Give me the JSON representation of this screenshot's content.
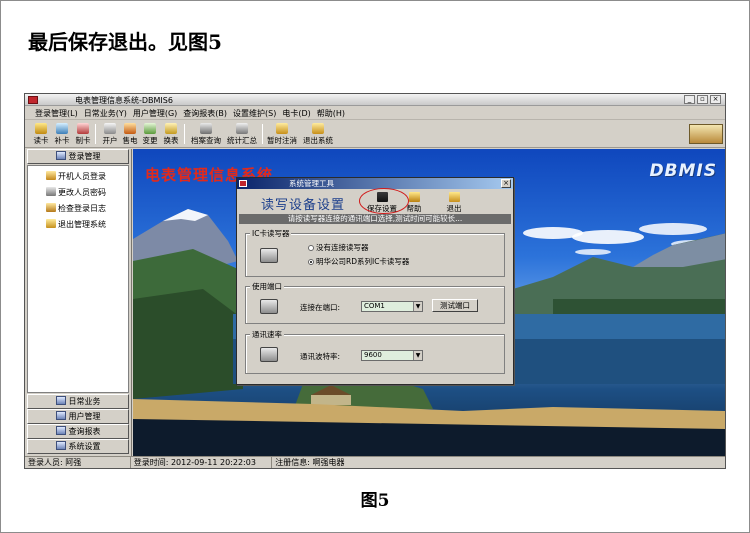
{
  "document": {
    "heading": "最后保存退出。见图5",
    "caption": "图5"
  },
  "app": {
    "title": "电表管理信息系统-DBMIS6",
    "window_buttons": [
      "_",
      "▫",
      "×"
    ],
    "menu": [
      "登录管理(L)",
      "日常业务(Y)",
      "用户管理(G)",
      "查询报表(B)",
      "设置维护(S)",
      "电卡(D)",
      "帮助(H)"
    ],
    "toolbar": [
      "读卡",
      "补卡",
      "制卡",
      "开户",
      "售电",
      "变更",
      "换表",
      "档案查询",
      "统计汇总",
      "暂时注消",
      "退出系统"
    ],
    "left_panel": {
      "top_header": "登录管理",
      "items": [
        "开机人员登录",
        "更改人员密码",
        "检查登录日志",
        "退出管理系统"
      ],
      "bottom_headers": [
        "日常业务",
        "用户管理",
        "查询报表",
        "系统设置"
      ]
    },
    "main": {
      "title": "电表管理信息系统",
      "brand": "DBMIS"
    },
    "status": {
      "user": "登录人员: 阿强",
      "time": "登录时间: 2012-09-11 20:22:03",
      "reg": "注册信息: 啊强电器"
    }
  },
  "dialog": {
    "title": "系统管理工具",
    "close": "×",
    "heading": "读写设备设置",
    "buttons": [
      "保存设置",
      "帮助",
      "退出"
    ],
    "hint": "请按读写器连接的通讯端口选择,测试时间可能较长...",
    "ic_group": {
      "title": "IC卡读写器",
      "options": [
        "没有连接读写器",
        "明华公司RD系列IC卡读写器"
      ],
      "selected": 1
    },
    "port_group": {
      "title": "使用端口",
      "label": "连接在端口:",
      "value": "COM1",
      "test_button": "测试端口"
    },
    "baud_group": {
      "title": "通讯速率",
      "label": "通讯波特率:",
      "value": "9600"
    }
  },
  "colors": {
    "main_title": "#e32a1a",
    "dialog_heading": "#1c3f8c",
    "highlight_oval": "#d11a1a",
    "title_bar": "#0a246a"
  }
}
